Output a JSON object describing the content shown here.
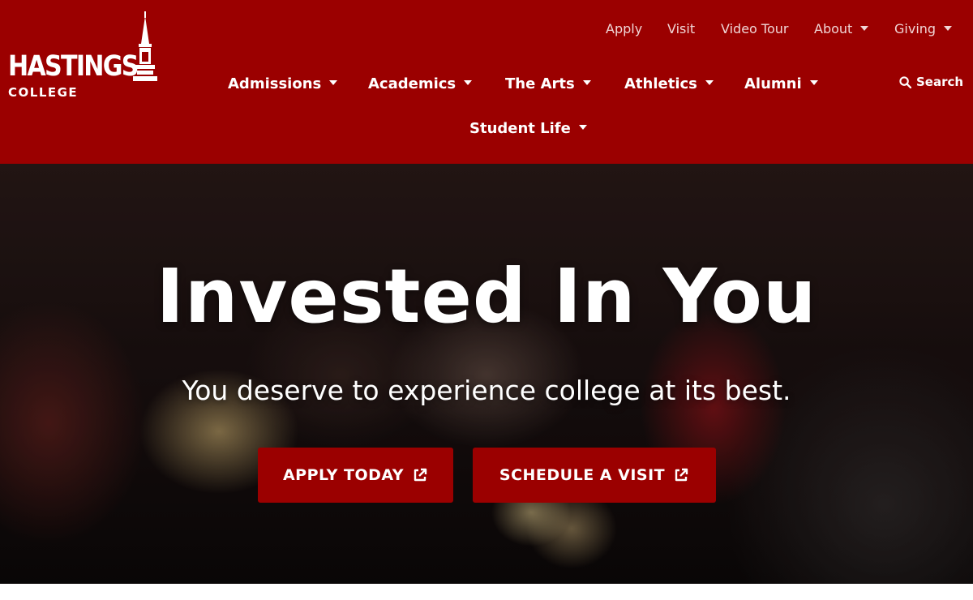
{
  "brand": {
    "logo_primary": "HASTINGS",
    "logo_secondary": "COLLEGE",
    "header_color": "#9b0000"
  },
  "utility_nav": {
    "items": [
      {
        "label": "Apply"
      },
      {
        "label": "Visit"
      },
      {
        "label": "Video Tour"
      },
      {
        "label": "About",
        "has_dropdown": true
      },
      {
        "label": "Giving",
        "has_dropdown": true
      }
    ]
  },
  "main_nav": {
    "items": [
      {
        "label": "Admissions",
        "has_dropdown": true
      },
      {
        "label": "Academics",
        "has_dropdown": true
      },
      {
        "label": "The Arts",
        "has_dropdown": true
      },
      {
        "label": "Athletics",
        "has_dropdown": true
      },
      {
        "label": "Alumni",
        "has_dropdown": true
      },
      {
        "label": "Student Life",
        "has_dropdown": true
      }
    ]
  },
  "search": {
    "label": "Search",
    "icon": "search-icon"
  },
  "hero": {
    "title": "Invested In You",
    "subtitle": "You deserve to experience college at its best.",
    "buttons": [
      {
        "label": "APPLY TODAY",
        "icon": "external-link-icon"
      },
      {
        "label": "SCHEDULE A VISIT",
        "icon": "external-link-icon"
      }
    ],
    "button_color": "#9b0000"
  }
}
